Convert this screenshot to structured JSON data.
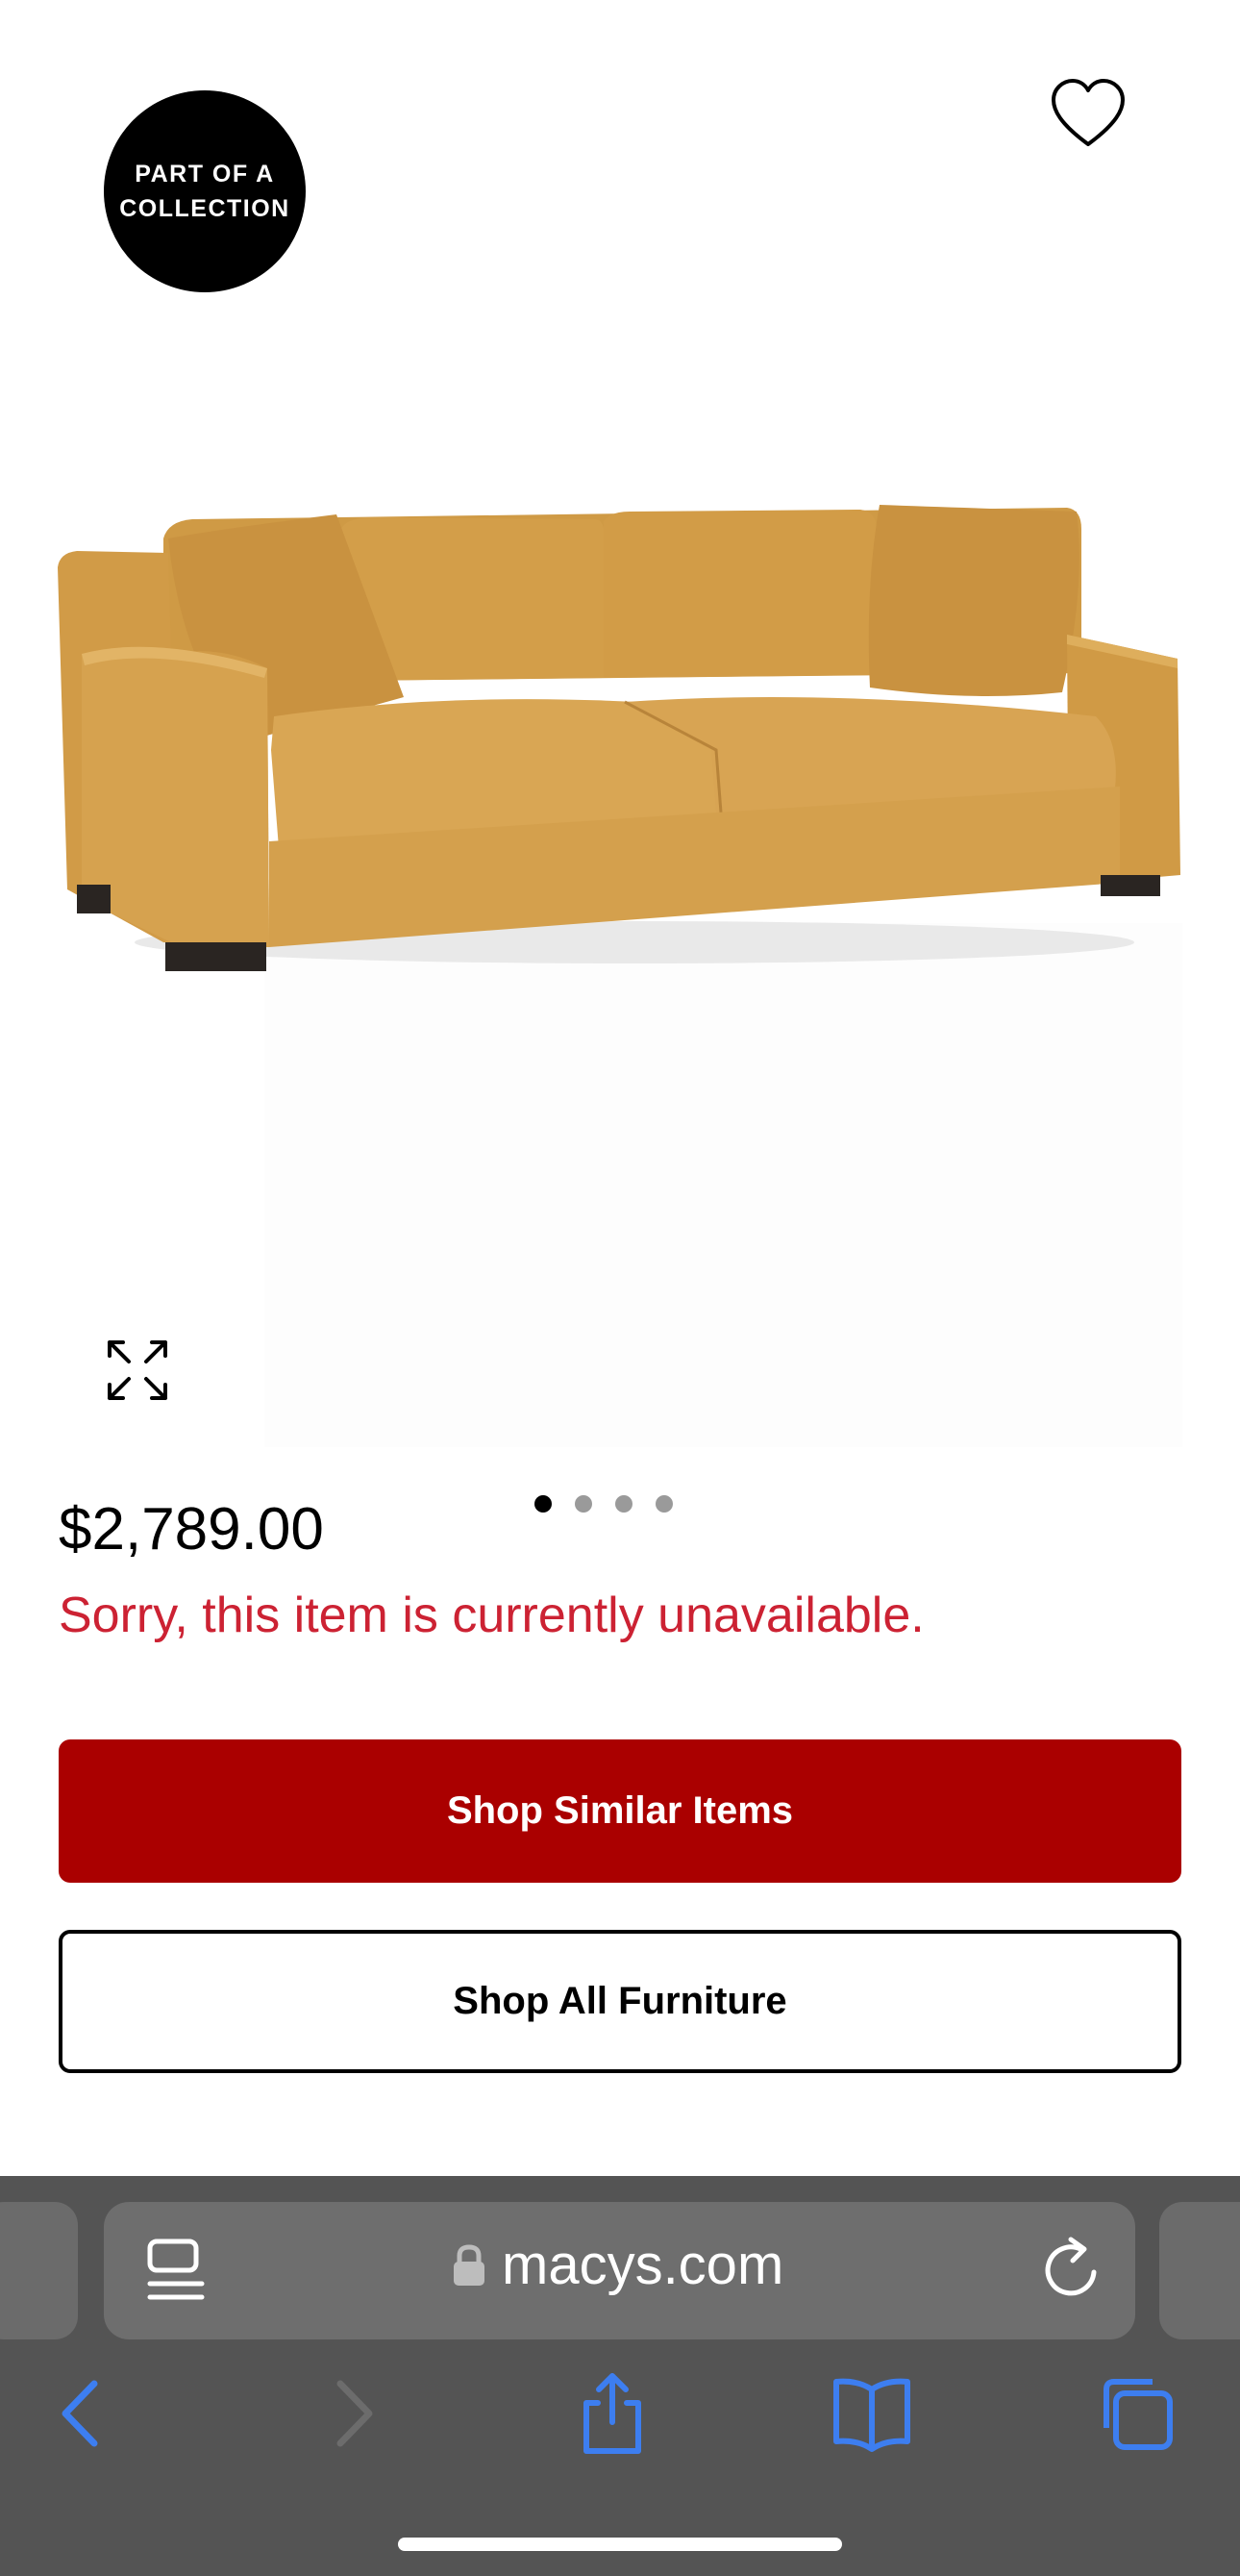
{
  "badge": {
    "line1": "PART OF A",
    "line2": "COLLECTION"
  },
  "product": {
    "image_alt": "Mustard velvet sofa",
    "colors": {
      "fabric": "#d6a14b",
      "legs": "#2a2522"
    }
  },
  "carousel": {
    "count": 4,
    "active": 0
  },
  "price": "$2,789.00",
  "status_message": "Sorry, this item is currently unavailable.",
  "buttons": {
    "similar": "Shop Similar Items",
    "all": "Shop All Furniture"
  },
  "browser": {
    "url": "macys.com"
  },
  "icons": {
    "favorite": "heart-icon",
    "expand": "expand-icon",
    "reader": "reader-icon",
    "lock": "lock-icon",
    "reload": "reload-icon",
    "back": "chevron-left-icon",
    "forward": "chevron-right-icon",
    "share": "share-icon",
    "bookmarks": "book-icon",
    "tabs": "tabs-icon"
  },
  "colors": {
    "accent_red": "#aa0000",
    "error_red": "#cc2233",
    "browser_bar": "#545454",
    "ios_blue": "#3d7ef0"
  }
}
